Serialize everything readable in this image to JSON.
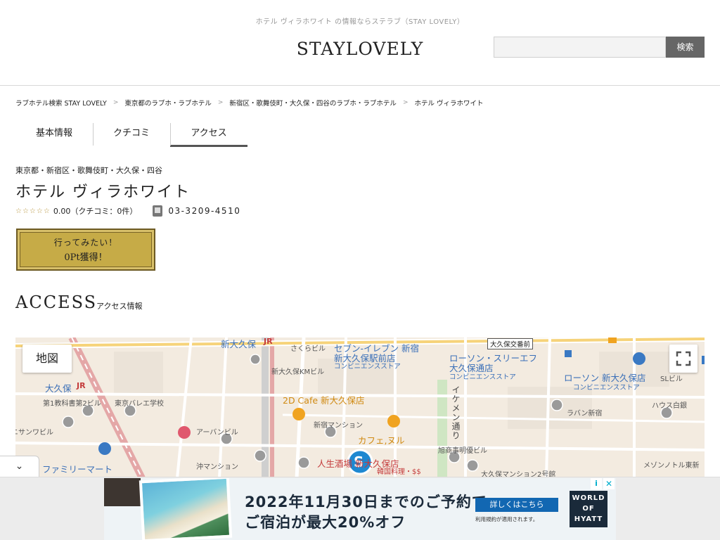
{
  "header": {
    "tagline": "ホテル ヴィラホワイト の情報ならステラブ（STAY LOVELY）",
    "logo": "STAYLOVELY",
    "search_placeholder": "",
    "search_button": "検索"
  },
  "breadcrumb": [
    "ラブホテル検索 STAY LOVELY",
    "東京都のラブホ・ラブホテル",
    "新宿区・歌舞伎町・大久保・四谷のラブホ・ラブホテル",
    "ホテル ヴィラホワイト"
  ],
  "breadcrumb_separator": ">",
  "tabs": [
    {
      "label": "基本情報",
      "active": false
    },
    {
      "label": "クチコミ",
      "active": false
    },
    {
      "label": "アクセス",
      "active": true
    }
  ],
  "hotel": {
    "area": "東京都・新宿区・歌舞伎町・大久保・四谷",
    "name": "ホテル ヴィラホワイト",
    "stars": "☆☆☆☆☆",
    "rating_text": "0.00（クチコミ：0件）",
    "phone": "03-3209-4510",
    "want_line1": "行ってみたい！",
    "want_line2": "0Pt獲得！"
  },
  "access": {
    "title": "ACCESS",
    "subtitle": "アクセス情報"
  },
  "map": {
    "type_button": "地図",
    "labels": {
      "shinokubo": "新大久保",
      "sakura": "さくらビル",
      "seven": "セブン-イレブン 新宿",
      "seven2": "新大久保駅前店",
      "conv1": "コンビニエンスストア",
      "kobancho": "大久保交番前",
      "lawson3f": "ローソン・スリーエフ",
      "lawson3f2": "大久保通店",
      "conv2": "コンビニエンスストア",
      "lawson": "ローソン 新大久保店",
      "conv3": "コンビニエンスストア",
      "slbldg": "SLビル",
      "okubo": "大久保",
      "kmbldg": "新大久保KMビル",
      "book": "第1教科書第2ビル",
      "ballet": "東京バレエ学校",
      "cafe2d": "2D Cafe 新大久保店",
      "ikemen": "イケメン通り",
      "raban": "ラバン新宿",
      "house": "ハウス白銀",
      "mansion": "新宿マンション",
      "cafe": "カフェ,ヌル",
      "urban": "アーバンビル",
      "nisan": "ニサンワビル",
      "asahi": "旭商事明優ビル",
      "family": "ファミリーマート",
      "oki": "沖マンション",
      "jinsei": "人生酒場 新大久保店",
      "korean": "韓国料理・$$",
      "okubo_mansion": "大久保マンション2号館",
      "maison": "メゾンノトル東新",
      "jr": "JR"
    }
  },
  "ad": {
    "line1": "2022年11月30日までのご予約で、",
    "line2": "ご宿泊が最大20%オフ",
    "cta": "詳しくはこちら",
    "fine": "利用規約が適用されます。",
    "brand": "WORLD OF HYATT",
    "brand1": "WORLD",
    "brand2": "OF",
    "brand3": "HYATT",
    "info": "i",
    "close": "✕"
  },
  "collapse_label": "⌄"
}
